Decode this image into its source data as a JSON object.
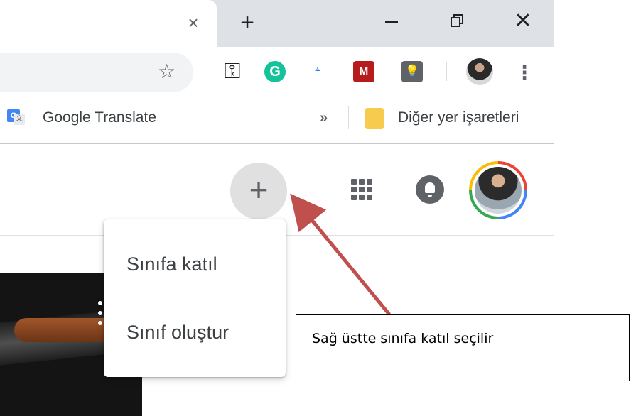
{
  "browser": {
    "tab_close_glyph": "×",
    "new_tab_glyph": "+",
    "window_close_glyph": "✕"
  },
  "toolbar": {
    "star_glyph": "☆",
    "extensions": [
      {
        "name": "key-extension-icon",
        "glyph": "⚿"
      },
      {
        "name": "grammarly-icon",
        "glyph": "G"
      },
      {
        "name": "meb-extension-icon",
        "glyph": "≜"
      },
      {
        "name": "m-extension-icon",
        "glyph": "M"
      },
      {
        "name": "bulb-extension-icon",
        "glyph": "💡"
      }
    ],
    "menu_glyph": "⋮"
  },
  "bookmarks": {
    "google_translate": "Google Translate",
    "more_glyph": "»",
    "other_bookmarks": "Diğer yer işaretleri"
  },
  "classroom": {
    "plus_glyph": "+",
    "menu": {
      "join_class": "Sınıfa katıl",
      "create_class": "Sınıf oluştur"
    }
  },
  "annotation": {
    "text": "Sağ üstte sınıfa katıl seçilir",
    "arrow_color": "#c0504d"
  },
  "colors": {
    "tabstrip": "#dee1e6",
    "omnibox": "#f1f3f4",
    "plus_button": "#e0e0e0",
    "icon_gray": "#5f6368"
  }
}
